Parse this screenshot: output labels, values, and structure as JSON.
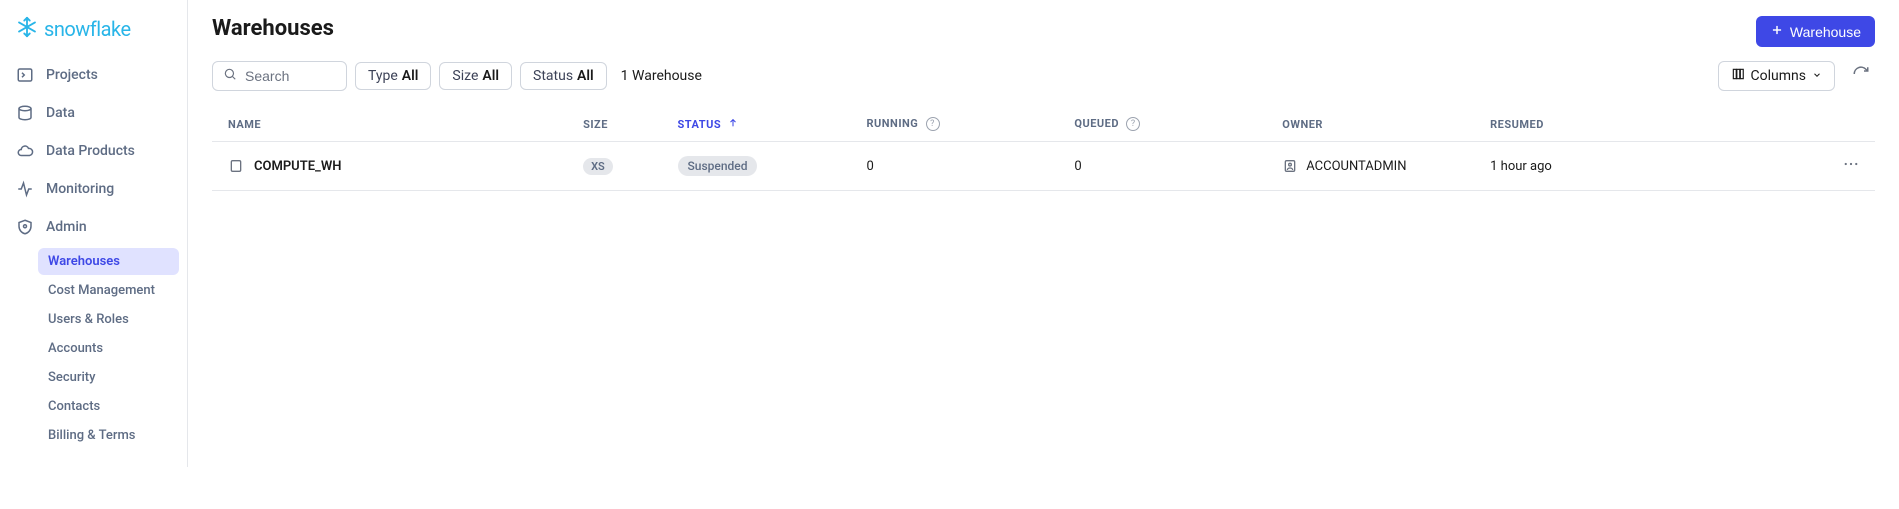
{
  "brand": "snowflake",
  "sidebar": {
    "items": [
      {
        "label": "Projects"
      },
      {
        "label": "Data"
      },
      {
        "label": "Data Products"
      },
      {
        "label": "Monitoring"
      },
      {
        "label": "Admin"
      }
    ],
    "admin_sub": [
      {
        "label": "Warehouses",
        "active": true
      },
      {
        "label": "Cost Management"
      },
      {
        "label": "Users & Roles"
      },
      {
        "label": "Accounts"
      },
      {
        "label": "Security"
      },
      {
        "label": "Contacts"
      },
      {
        "label": "Billing & Terms"
      }
    ]
  },
  "page": {
    "title": "Warehouses",
    "primary_button": "Warehouse"
  },
  "filters": {
    "search_placeholder": "Search",
    "type": {
      "label": "Type",
      "value": "All"
    },
    "size": {
      "label": "Size",
      "value": "All"
    },
    "status": {
      "label": "Status",
      "value": "All"
    },
    "count_label": "1 Warehouse",
    "columns_button": "Columns"
  },
  "table": {
    "headers": {
      "name": "NAME",
      "size": "SIZE",
      "status": "STATUS",
      "running": "RUNNING",
      "queued": "QUEUED",
      "owner": "OWNER",
      "resumed": "RESUMED"
    },
    "rows": [
      {
        "name": "COMPUTE_WH",
        "size": "XS",
        "status": "Suspended",
        "running": "0",
        "queued": "0",
        "owner": "ACCOUNTADMIN",
        "resumed": "1 hour ago"
      }
    ]
  }
}
